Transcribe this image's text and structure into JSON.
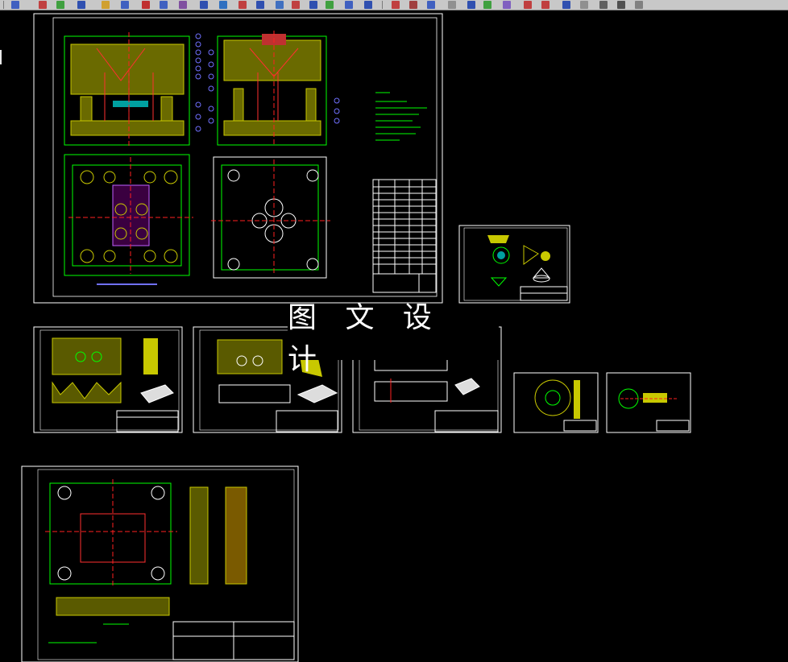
{
  "watermark": {
    "text": "图 文 设 计"
  },
  "toolbar": {
    "icons": [
      "arrow-icon",
      "pencil-icon",
      "line-icon",
      "box-icon",
      "circle-icon",
      "hatch-icon",
      "text-icon",
      "dimension-icon",
      "layer-icon",
      "snap-icon",
      "block-icon",
      "move-icon",
      "rotate-icon",
      "scale-icon",
      "zoom-icon",
      "pan-icon",
      "print-icon",
      "undo-icon",
      "redo-icon",
      "help-icon"
    ]
  },
  "colors": {
    "background": "#000000",
    "sheet_border": "#ffffff",
    "hatch": "#c8c800",
    "geometry": "#00ff00",
    "center": "#ff2020",
    "balloon": "#7070ff",
    "dim": "#00e0e0"
  }
}
